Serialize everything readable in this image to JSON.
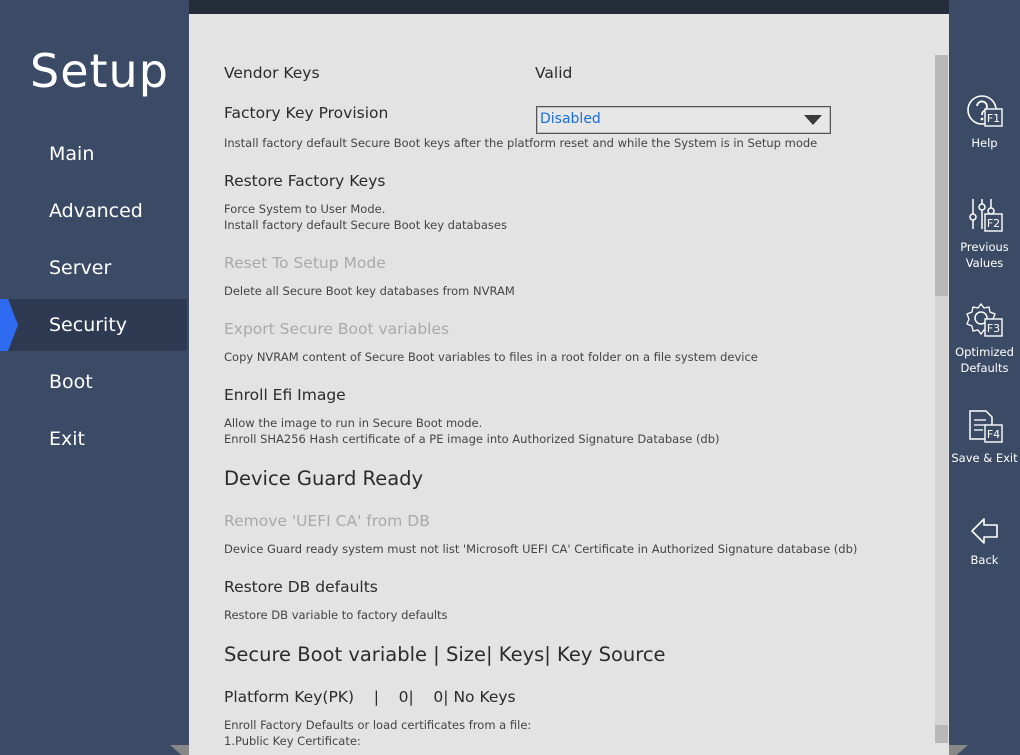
{
  "app": {
    "title": "Setup"
  },
  "nav": [
    {
      "label": "Main"
    },
    {
      "label": "Advanced"
    },
    {
      "label": "Server"
    },
    {
      "label": "Security"
    },
    {
      "label": "Boot"
    },
    {
      "label": "Exit"
    }
  ],
  "accent": "#2f6bf2",
  "selected_color": "#1a6fd6",
  "content": {
    "vendor_keys": {
      "label": "Vendor Keys",
      "value": "Valid"
    },
    "factory_key_provision": {
      "label": "Factory Key Provision",
      "value": "Disabled",
      "help": "Install factory default Secure Boot keys after the platform reset and while the System is in Setup mode"
    },
    "restore_factory_keys": {
      "label": "Restore Factory Keys",
      "help1": "Force System to User Mode.",
      "help2": "Install factory default Secure Boot key databases"
    },
    "reset_to_setup_mode": {
      "label": "Reset To Setup Mode",
      "help": "Delete all Secure Boot key databases from NVRAM"
    },
    "export_secure_boot": {
      "label": "Export Secure Boot variables",
      "help": "Copy NVRAM content of Secure Boot variables to files in a root folder on a file system device"
    },
    "enroll_efi_image": {
      "label": "Enroll Efi Image",
      "help1": "Allow the image to run in Secure Boot mode.",
      "help2": "Enroll SHA256 Hash certificate of a PE image into Authorized Signature Database (db)"
    },
    "device_guard_header": "Device Guard Ready",
    "remove_uefi_ca": {
      "label": "Remove 'UEFI CA' from DB",
      "help": "Device Guard ready system must not list 'Microsoft UEFI CA' Certificate in Authorized Signature database (db)"
    },
    "restore_db_defaults": {
      "label": "Restore DB defaults",
      "help": "Restore DB variable to factory defaults"
    },
    "secure_boot_table_header": "Secure Boot variable | Size| Keys| Key Source",
    "platform_key": {
      "label": "Platform Key(PK)    |    0|    0| No Keys",
      "help1": "Enroll Factory Defaults or load certificates from a file:",
      "help2": "1.Public Key Certificate:"
    }
  },
  "function_keys": [
    {
      "label": "Help",
      "key": "F1",
      "icon": "help-icon"
    },
    {
      "label": "Previous\nValues",
      "key": "F2",
      "icon": "sliders-icon"
    },
    {
      "label": "Optimized\nDefaults",
      "key": "F3",
      "icon": "gear-icon"
    },
    {
      "label": "Save & Exit",
      "key": "F4",
      "icon": "document-icon"
    },
    {
      "label": "Back",
      "key": "",
      "icon": "back-arrow-icon"
    }
  ]
}
